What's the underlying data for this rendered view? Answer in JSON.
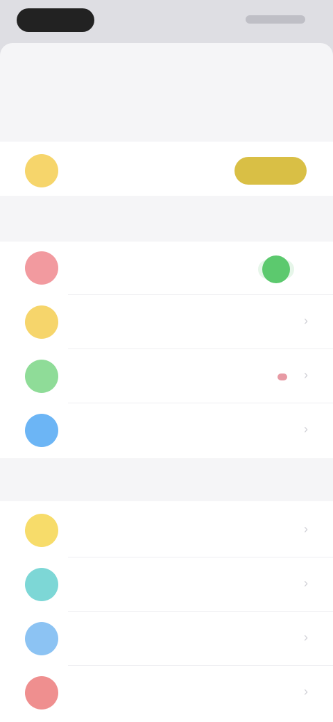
{
  "colors": {
    "account_icon": "#f6d56b",
    "upgrade": "#d9bf45",
    "notifications": "#f29a9f",
    "reminders": "#f6d56b",
    "theme": "#8fdc98",
    "widgets": "#6cb5f5",
    "help": "#f7dc6a",
    "chat": "#7dd7d6",
    "feedback": "#8cc3f3",
    "privacy": "#ef8f8f",
    "toggle_on": "#5cc96e"
  },
  "icons": {
    "account": "user-icon",
    "notifications": "bell-icon",
    "reminders": "alarm-icon",
    "theme": "palette-icon",
    "widgets": "grid-icon",
    "help": "help-icon",
    "chat": "chat-icon",
    "feedback": "star-icon",
    "privacy": "lock-icon"
  },
  "notifications_enabled": true
}
